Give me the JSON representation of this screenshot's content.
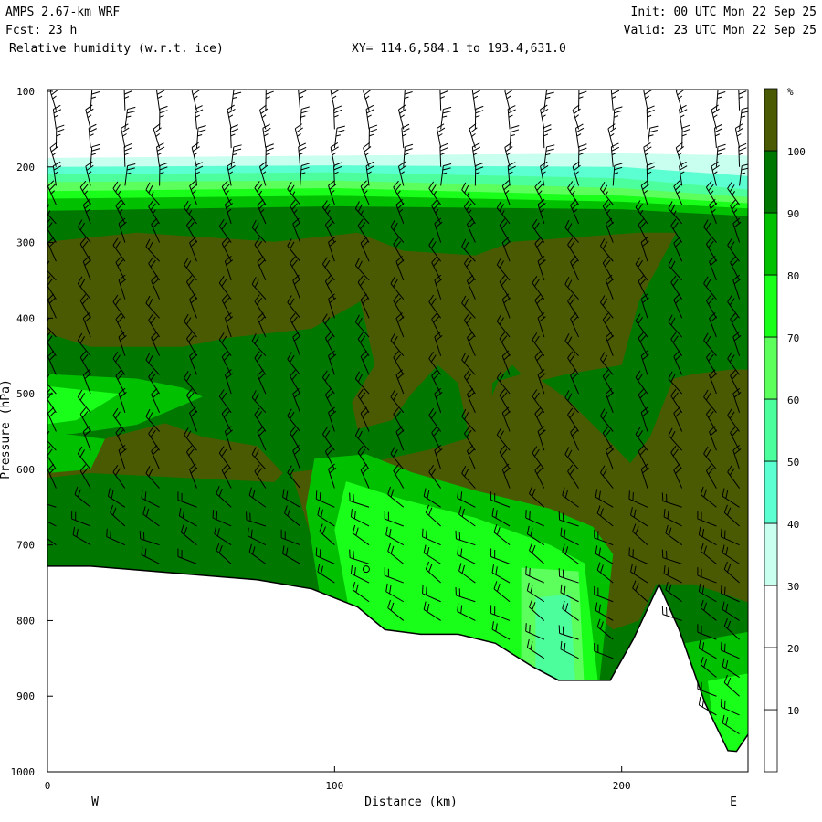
{
  "header": {
    "model": "AMPS 2.67-km WRF",
    "forecast": "Fcst:   23 h",
    "field": "Relative humidity (w.r.t. ice)",
    "xy_range": "XY= 114.6,584.1 to 193.4,631.0",
    "init": "Init: 00 UTC Mon 22 Sep 25",
    "valid": "Valid: 23 UTC Mon 22 Sep 25"
  },
  "chart_data": {
    "type": "heatmap",
    "title": "Relative humidity (w.r.t. ice)",
    "xlabel": "Distance (km)",
    "ylabel": "Pressure (hPa)",
    "xlim": [
      0,
      244
    ],
    "ylim": [
      1000,
      100
    ],
    "x_ticks": [
      "0",
      "100",
      "200"
    ],
    "x_tick_values": [
      0,
      100,
      200
    ],
    "y_ticks": [
      "100",
      "200",
      "300",
      "400",
      "500",
      "600",
      "700",
      "800",
      "900",
      "1000"
    ],
    "y_tick_values": [
      100,
      200,
      300,
      400,
      500,
      600,
      700,
      800,
      900,
      1000
    ],
    "x_end_labels": {
      "left": "W",
      "right": "E"
    },
    "colorbar": {
      "unit": "%",
      "levels": [
        "10",
        "20",
        "30",
        "40",
        "50",
        "60",
        "70",
        "80",
        "90",
        "100"
      ],
      "level_values": [
        10,
        20,
        30,
        40,
        50,
        60,
        70,
        80,
        90,
        100
      ],
      "colors": [
        "#ffffff",
        "#ffffff",
        "#ffffff",
        "#c8ffee",
        "#5cffd2",
        "#4dff9c",
        "#5cff5c",
        "#1aff1a",
        "#00c000",
        "#007800",
        "#4a5a02"
      ]
    },
    "background_rh_class": "90-100",
    "top_bands": [
      {
        "color": "#ffffff",
        "boundary_km": [
          0,
          100,
          200,
          244
        ],
        "boundary_hPa": [
          188,
          185,
          182,
          185
        ]
      },
      {
        "color": "#c8ffee",
        "boundary_km": [
          0,
          100,
          200,
          244
        ],
        "boundary_hPa": [
          200,
          198,
          200,
          212
        ]
      },
      {
        "color": "#5cffd2",
        "boundary_km": [
          0,
          100,
          200,
          244
        ],
        "boundary_hPa": [
          210,
          207,
          215,
          230
        ]
      },
      {
        "color": "#4dff9c",
        "boundary_km": [
          0,
          100,
          200,
          244
        ],
        "boundary_hPa": [
          220,
          218,
          228,
          240
        ]
      },
      {
        "color": "#5cff5c",
        "boundary_km": [
          0,
          100,
          200,
          244
        ],
        "boundary_hPa": [
          232,
          228,
          238,
          248
        ]
      },
      {
        "color": "#1aff1a",
        "boundary_km": [
          0,
          100,
          200,
          244
        ],
        "boundary_hPa": [
          242,
          238,
          246,
          255
        ]
      },
      {
        "color": "#00c000",
        "boundary_km": [
          0,
          100,
          200,
          244
        ],
        "boundary_hPa": [
          258,
          252,
          256,
          265
        ]
      }
    ],
    "regions": [
      {
        "rh": ">100",
        "color": "#4a5a02",
        "points": [
          [
            0,
            299
          ],
          [
            31,
            287
          ],
          [
            79,
            299
          ],
          [
            108,
            287
          ],
          [
            124,
            311
          ],
          [
            149,
            317
          ],
          [
            162,
            299
          ],
          [
            206,
            287
          ],
          [
            219,
            287
          ],
          [
            206,
            378
          ],
          [
            200,
            462
          ],
          [
            181,
            474
          ],
          [
            168,
            486
          ],
          [
            162,
            462
          ],
          [
            155,
            486
          ],
          [
            154,
            589
          ],
          [
            149,
            595
          ],
          [
            143,
            486
          ],
          [
            136,
            462
          ],
          [
            127,
            499
          ],
          [
            120,
            535
          ],
          [
            108,
            547
          ],
          [
            106,
            511
          ],
          [
            114,
            462
          ],
          [
            109,
            378
          ],
          [
            92,
            414
          ],
          [
            63,
            426
          ],
          [
            47,
            438
          ],
          [
            15,
            438
          ],
          [
            0,
            420
          ]
        ]
      },
      {
        "rh": ">100",
        "color": "#4a5a02",
        "points": [
          [
            0,
            593
          ],
          [
            22,
            557
          ],
          [
            41,
            539
          ],
          [
            54,
            557
          ],
          [
            73,
            569
          ],
          [
            82,
            605
          ],
          [
            79,
            617
          ],
          [
            47,
            611
          ],
          [
            15,
            605
          ],
          [
            0,
            611
          ]
        ]
      },
      {
        "rh": ">100",
        "color": "#4a5a02",
        "points": [
          [
            85,
            604
          ],
          [
            111,
            592
          ],
          [
            133,
            574
          ],
          [
            149,
            556
          ],
          [
            157,
            483
          ],
          [
            168,
            471
          ],
          [
            181,
            507
          ],
          [
            194,
            556
          ],
          [
            203,
            592
          ],
          [
            210,
            556
          ],
          [
            218,
            480
          ],
          [
            225,
            474
          ],
          [
            238,
            468
          ],
          [
            244,
            468
          ],
          [
            244,
            776
          ],
          [
            235,
            764
          ],
          [
            225,
            752
          ],
          [
            212,
            752
          ],
          [
            206,
            800
          ],
          [
            197,
            812
          ],
          [
            187,
            776
          ],
          [
            175,
            752
          ],
          [
            162,
            740
          ],
          [
            143,
            728
          ],
          [
            117,
            704
          ],
          [
            92,
            692
          ]
        ]
      },
      {
        "rh": "80-90",
        "color": "#00c000",
        "points": [
          [
            0,
            474
          ],
          [
            31,
            480
          ],
          [
            47,
            492
          ],
          [
            54,
            504
          ],
          [
            31,
            541
          ],
          [
            9,
            553
          ],
          [
            0,
            553
          ]
        ]
      },
      {
        "rh": "70-80",
        "color": "#1aff1a",
        "points": [
          [
            0,
            490
          ],
          [
            25,
            500
          ],
          [
            10,
            535
          ],
          [
            0,
            540
          ]
        ]
      },
      {
        "rh": "80-90",
        "color": "#00c000",
        "points": [
          [
            0,
            550
          ],
          [
            20,
            560
          ],
          [
            15,
            600
          ],
          [
            0,
            605
          ]
        ]
      },
      {
        "rh": "80-90",
        "color": "#00c000",
        "points": [
          [
            93,
            586
          ],
          [
            111,
            580
          ],
          [
            127,
            604
          ],
          [
            149,
            628
          ],
          [
            175,
            652
          ],
          [
            190,
            676
          ],
          [
            197,
            712
          ],
          [
            192,
            890
          ],
          [
            100,
            890
          ],
          [
            90,
            650
          ]
        ]
      },
      {
        "rh": "70-80",
        "color": "#1aff1a",
        "points": [
          [
            104,
            616
          ],
          [
            124,
            640
          ],
          [
            149,
            664
          ],
          [
            175,
            700
          ],
          [
            187,
            724
          ],
          [
            192,
            890
          ],
          [
            110,
            890
          ],
          [
            100,
            680
          ]
        ]
      },
      {
        "rh": "60-70",
        "color": "#5cff5c",
        "points": [
          [
            165,
            730
          ],
          [
            185,
            735
          ],
          [
            187,
            890
          ],
          [
            165,
            890
          ]
        ]
      },
      {
        "rh": "50-60",
        "color": "#4dff9c",
        "points": [
          [
            170,
            770
          ],
          [
            182,
            765
          ],
          [
            184,
            890
          ],
          [
            170,
            890
          ]
        ]
      },
      {
        "rh": "80-90",
        "color": "#00c000",
        "points": [
          [
            222,
            830
          ],
          [
            244,
            815
          ],
          [
            244,
            1000
          ],
          [
            228,
            1000
          ]
        ]
      },
      {
        "rh": "70-80",
        "color": "#1aff1a",
        "points": [
          [
            230,
            880
          ],
          [
            244,
            870
          ],
          [
            244,
            1000
          ],
          [
            234,
            1000
          ]
        ]
      }
    ],
    "terrain_surface": {
      "distance_km": [
        0,
        15,
        47,
        73,
        92,
        108,
        117.5,
        130,
        143,
        156,
        169,
        178,
        196,
        204,
        213,
        220,
        229,
        237,
        240,
        245
      ],
      "pressure_hPa": [
        728,
        728,
        738,
        746,
        758,
        782,
        812,
        818,
        818,
        830,
        861,
        879,
        879,
        825,
        752,
        812,
        909,
        972,
        973,
        945
      ]
    },
    "marker": {
      "distance_km": 111,
      "pressure_hPa": 732
    },
    "wind_barbs": {
      "distances_km": [
        3,
        15,
        27,
        39,
        52,
        64,
        76,
        88,
        100,
        112,
        124,
        137,
        149,
        161,
        173,
        185,
        197,
        209,
        221,
        233,
        241
      ],
      "pressure_levels_hPa": [
        125,
        150,
        175,
        200,
        225,
        250,
        275,
        300,
        325,
        350,
        375,
        400,
        425,
        450,
        475,
        500,
        525,
        550,
        575,
        600,
        625,
        650,
        675,
        700,
        725,
        750,
        775,
        800,
        825,
        850,
        875,
        900,
        925,
        950
      ],
      "speed_kt": 25
    }
  }
}
